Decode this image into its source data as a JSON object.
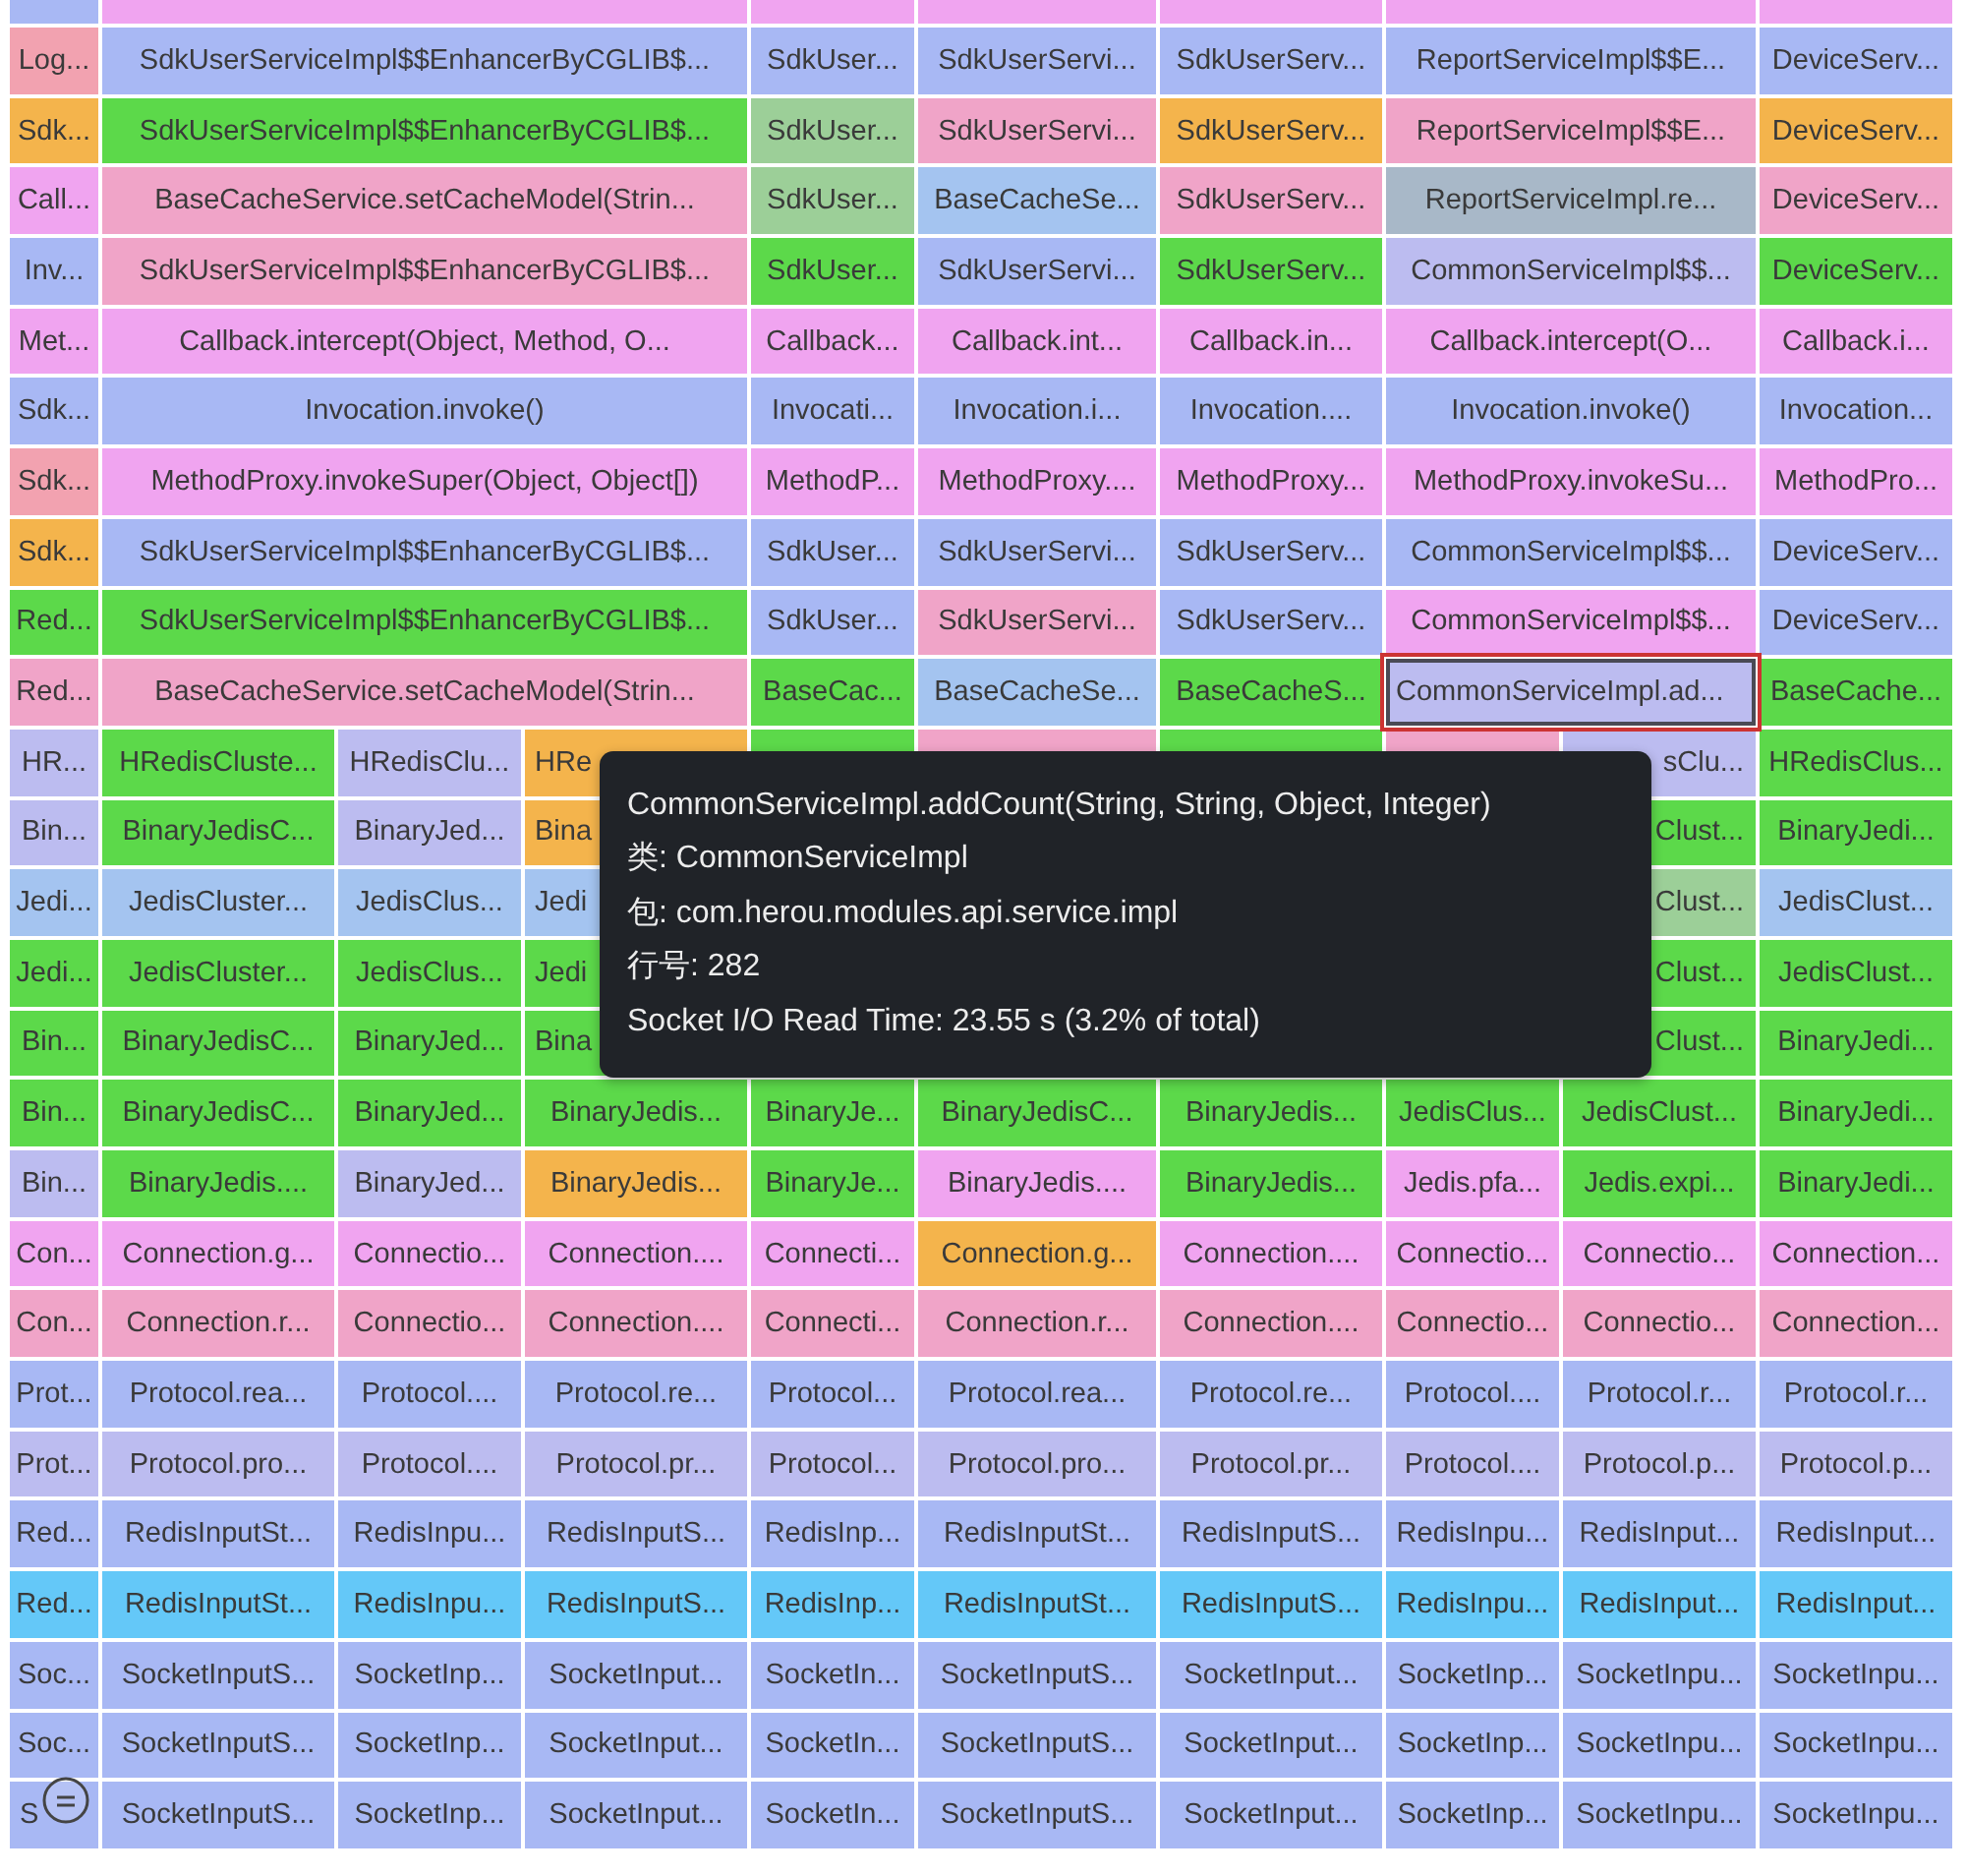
{
  "flame_graph": {
    "rows": [
      {
        "frames": [
          {
            "kind": "bare",
            "color": "#a8b8f4",
            "selected": false
          },
          {
            "kind": "bare",
            "color": "#f0a4f0",
            "selected": false
          },
          {
            "kind": "bare",
            "color": "#f0a4f0",
            "selected": false
          },
          {
            "kind": "bare",
            "color": "#f0a4f0",
            "selected": false
          },
          {
            "kind": "bare",
            "color": "#f0a4f0",
            "selected": false
          },
          {
            "kind": "bare",
            "color": "#f0a4f0",
            "selected": false
          },
          {
            "kind": "bare",
            "color": "#f0a4f0",
            "selected": false
          }
        ]
      },
      {
        "frames": [
          {
            "label": "Log...",
            "color": "#f2a2b0",
            "selected": false
          },
          {
            "label": "SdkUserServiceImpl$$EnhancerByCGLIB$...",
            "color": "#a8b8f4",
            "selected": false
          },
          {
            "label": "SdkUser...",
            "color": "#a8b8f4",
            "selected": false
          },
          {
            "label": "SdkUserServi...",
            "color": "#a8b8f4",
            "selected": false
          },
          {
            "label": "SdkUserServ...",
            "color": "#a8b8f4",
            "selected": false
          },
          {
            "label": "ReportServiceImpl$$E...",
            "color": "#a8b8f4",
            "selected": false
          },
          {
            "label": "DeviceServ...",
            "color": "#a8b8f4",
            "selected": false
          }
        ]
      },
      {
        "frames": [
          {
            "label": "Sdk...",
            "color": "#f4b44c",
            "selected": false
          },
          {
            "label": "SdkUserServiceImpl$$EnhancerByCGLIB$...",
            "color": "#5cd94a",
            "selected": false
          },
          {
            "label": "SdkUser...",
            "color": "#9ccf98",
            "selected": false
          },
          {
            "label": "SdkUserServi...",
            "color": "#f0a4c8",
            "selected": false
          },
          {
            "label": "SdkUserServ...",
            "color": "#f4b44c",
            "selected": false
          },
          {
            "label": "ReportServiceImpl$$E...",
            "color": "#f0a4c8",
            "selected": false
          },
          {
            "label": "DeviceServ...",
            "color": "#f4b44c",
            "selected": false
          }
        ]
      },
      {
        "frames": [
          {
            "label": "Call...",
            "color": "#f0a4f0",
            "selected": false
          },
          {
            "label": "BaseCacheService.setCacheModel(Strin...",
            "color": "#f0a4c8",
            "selected": false
          },
          {
            "label": "SdkUser...",
            "color": "#9ccf98",
            "selected": false
          },
          {
            "label": "BaseCacheSe...",
            "color": "#a4c4f0",
            "selected": false
          },
          {
            "label": "SdkUserServ...",
            "color": "#f0a4c8",
            "selected": false
          },
          {
            "label": "ReportServiceImpl.re...",
            "color": "#a8b8c8",
            "selected": false
          },
          {
            "label": "DeviceServ...",
            "color": "#f0a4c8",
            "selected": false
          }
        ]
      },
      {
        "frames": [
          {
            "label": "Inv...",
            "color": "#a8b8f4",
            "selected": false
          },
          {
            "label": "SdkUserServiceImpl$$EnhancerByCGLIB$...",
            "color": "#f0a4c8",
            "selected": false
          },
          {
            "label": "SdkUser...",
            "color": "#5cd94a",
            "selected": false
          },
          {
            "label": "SdkUserServi...",
            "color": "#a8b8f4",
            "selected": false
          },
          {
            "label": "SdkUserServ...",
            "color": "#5cd94a",
            "selected": false
          },
          {
            "label": "CommonServiceImpl$$...",
            "color": "#bcbcf0",
            "selected": false
          },
          {
            "label": "DeviceServ...",
            "color": "#5cd94a",
            "selected": false
          }
        ]
      },
      {
        "frames": [
          {
            "label": "Met...",
            "color": "#f0a4f0",
            "selected": false
          },
          {
            "label": "Callback.intercept(Object, Method, O...",
            "color": "#f0a4f0",
            "selected": false
          },
          {
            "label": "Callback...",
            "color": "#f0a4f0",
            "selected": false
          },
          {
            "label": "Callback.int...",
            "color": "#f0a4f0",
            "selected": false
          },
          {
            "label": "Callback.in...",
            "color": "#f0a4f0",
            "selected": false
          },
          {
            "label": "Callback.intercept(O...",
            "color": "#f0a4f0",
            "selected": false
          },
          {
            "label": "Callback.i...",
            "color": "#f0a4f0",
            "selected": false
          }
        ]
      },
      {
        "frames": [
          {
            "label": "Sdk...",
            "color": "#a8b8f4",
            "selected": false
          },
          {
            "label": "Invocation.invoke()",
            "color": "#a8b8f4",
            "selected": false
          },
          {
            "label": "Invocati...",
            "color": "#a8b8f4",
            "selected": false
          },
          {
            "label": "Invocation.i...",
            "color": "#a8b8f4",
            "selected": false
          },
          {
            "label": "Invocation....",
            "color": "#a8b8f4",
            "selected": false
          },
          {
            "label": "Invocation.invoke()",
            "color": "#a8b8f4",
            "selected": false
          },
          {
            "label": "Invocation...",
            "color": "#a8b8f4",
            "selected": false
          }
        ]
      },
      {
        "frames": [
          {
            "label": "Sdk...",
            "color": "#f2a2b0",
            "selected": false
          },
          {
            "label": "MethodProxy.invokeSuper(Object, Object[])",
            "color": "#f0a4f0",
            "selected": false
          },
          {
            "label": "MethodP...",
            "color": "#f0a4f0",
            "selected": false
          },
          {
            "label": "MethodProxy....",
            "color": "#f0a4f0",
            "selected": false
          },
          {
            "label": "MethodProxy...",
            "color": "#f0a4f0",
            "selected": false
          },
          {
            "label": "MethodProxy.invokeSu...",
            "color": "#f0a4f0",
            "selected": false
          },
          {
            "label": "MethodPro...",
            "color": "#f0a4f0",
            "selected": false
          }
        ]
      },
      {
        "frames": [
          {
            "label": "Sdk...",
            "color": "#f4b44c",
            "selected": false
          },
          {
            "label": "SdkUserServiceImpl$$EnhancerByCGLIB$...",
            "color": "#a8b8f4",
            "selected": false
          },
          {
            "label": "SdkUser...",
            "color": "#a8b8f4",
            "selected": false
          },
          {
            "label": "SdkUserServi...",
            "color": "#a8b8f4",
            "selected": false
          },
          {
            "label": "SdkUserServ...",
            "color": "#a8b8f4",
            "selected": false
          },
          {
            "label": "CommonServiceImpl$$...",
            "color": "#a8b8f4",
            "selected": false
          },
          {
            "label": "DeviceServ...",
            "color": "#a8b8f4",
            "selected": false
          }
        ]
      },
      {
        "frames": [
          {
            "label": "Red...",
            "color": "#5cd94a",
            "selected": false
          },
          {
            "label": "SdkUserServiceImpl$$EnhancerByCGLIB$...",
            "color": "#5cd94a",
            "selected": false
          },
          {
            "label": "SdkUser...",
            "color": "#a8b8f4",
            "selected": false
          },
          {
            "label": "SdkUserServi...",
            "color": "#f0a4c8",
            "selected": false
          },
          {
            "label": "SdkUserServ...",
            "color": "#a8b8f4",
            "selected": false
          },
          {
            "label": "CommonServiceImpl$$...",
            "color": "#f0a4f0",
            "selected": false
          },
          {
            "label": "DeviceServ...",
            "color": "#a8b8f4",
            "selected": false
          }
        ]
      },
      {
        "frames": [
          {
            "label": "Red...",
            "color": "#f0a4c8",
            "selected": false
          },
          {
            "label": "BaseCacheService.setCacheModel(Strin...",
            "color": "#f0a4c8",
            "selected": false
          },
          {
            "label": "BaseCac...",
            "color": "#5cd94a",
            "selected": false
          },
          {
            "label": "BaseCacheSe...",
            "color": "#a4c4f0",
            "selected": false
          },
          {
            "label": "BaseCacheS...",
            "color": "#5cd94a",
            "selected": false
          },
          {
            "label": "CommonServiceImpl.ad...",
            "color": "#bcbcf0",
            "selected": true
          },
          {
            "label": "BaseCache...",
            "color": "#5cd94a",
            "selected": false
          }
        ]
      },
      {
        "frames": [
          {
            "label": "HR...",
            "color": "#bcbcf0",
            "selected": false
          },
          {
            "label": "HRedisCluste...",
            "color": "#5cd94a",
            "selected": false
          },
          {
            "label": "HRedisClu...",
            "color": "#bcbcf0",
            "selected": false
          },
          {
            "kind": "partial-left",
            "label": "HRe",
            "color": "#f4b44c",
            "selected": false
          },
          {
            "kind": "bare",
            "color": "#5cd94a",
            "selected": false
          },
          {
            "kind": "bare",
            "color": "#f0a4c8",
            "selected": false
          },
          {
            "kind": "bare",
            "color": "#5cd94a",
            "selected": false
          },
          {
            "kind": "bare",
            "color": "#f0a4c8",
            "selected": false
          },
          {
            "kind": "partial-right",
            "label": "sClu...",
            "color": "#bcbcf0",
            "selected": false
          },
          {
            "label": "HRedisClus...",
            "color": "#5cd94a",
            "selected": false
          }
        ]
      },
      {
        "frames": [
          {
            "label": "Bin...",
            "color": "#bcbcf0",
            "selected": false
          },
          {
            "label": "BinaryJedisC...",
            "color": "#5cd94a",
            "selected": false
          },
          {
            "label": "BinaryJed...",
            "color": "#bcbcf0",
            "selected": false
          },
          {
            "kind": "partial-left",
            "label": "Bina",
            "color": "#f4b44c",
            "selected": false
          },
          {
            "kind": "hidden"
          },
          {
            "kind": "hidden"
          },
          {
            "kind": "hidden"
          },
          {
            "kind": "hidden"
          },
          {
            "kind": "partial-right",
            "label": "Clust...",
            "color": "#5cd94a",
            "selected": false
          },
          {
            "label": "BinaryJedi...",
            "color": "#5cd94a",
            "selected": false
          }
        ]
      },
      {
        "frames": [
          {
            "label": "Jedi...",
            "color": "#a4c4f0",
            "selected": false
          },
          {
            "label": "JedisCluster...",
            "color": "#a4c4f0",
            "selected": false
          },
          {
            "label": "JedisClus...",
            "color": "#a4c4f0",
            "selected": false
          },
          {
            "kind": "partial-left",
            "label": "Jedi",
            "color": "#a4c4f0",
            "selected": false
          },
          {
            "kind": "hidden"
          },
          {
            "kind": "hidden"
          },
          {
            "kind": "hidden"
          },
          {
            "kind": "hidden"
          },
          {
            "kind": "partial-right",
            "label": "Clust...",
            "color": "#9ccf98",
            "selected": false
          },
          {
            "label": "JedisClust...",
            "color": "#a4c4f0",
            "selected": false
          }
        ]
      },
      {
        "frames": [
          {
            "label": "Jedi...",
            "color": "#5cd94a",
            "selected": false
          },
          {
            "label": "JedisCluster...",
            "color": "#5cd94a",
            "selected": false
          },
          {
            "label": "JedisClus...",
            "color": "#5cd94a",
            "selected": false
          },
          {
            "kind": "partial-left",
            "label": "Jedi",
            "color": "#5cd94a",
            "selected": false
          },
          {
            "kind": "hidden"
          },
          {
            "kind": "hidden"
          },
          {
            "kind": "hidden"
          },
          {
            "kind": "hidden"
          },
          {
            "kind": "partial-right",
            "label": "Clust...",
            "color": "#5cd94a",
            "selected": false
          },
          {
            "label": "JedisClust...",
            "color": "#5cd94a",
            "selected": false
          }
        ]
      },
      {
        "frames": [
          {
            "label": "Bin...",
            "color": "#5cd94a",
            "selected": false
          },
          {
            "label": "BinaryJedisC...",
            "color": "#5cd94a",
            "selected": false
          },
          {
            "label": "BinaryJed...",
            "color": "#5cd94a",
            "selected": false
          },
          {
            "kind": "partial-left",
            "label": "Bina",
            "color": "#5cd94a",
            "selected": false
          },
          {
            "kind": "hidden"
          },
          {
            "kind": "hidden"
          },
          {
            "kind": "hidden"
          },
          {
            "kind": "hidden"
          },
          {
            "kind": "partial-right",
            "label": "Clust...",
            "color": "#5cd94a",
            "selected": false
          },
          {
            "label": "BinaryJedi...",
            "color": "#5cd94a",
            "selected": false
          }
        ]
      },
      {
        "frames": [
          {
            "label": "Bin...",
            "color": "#5cd94a",
            "selected": false
          },
          {
            "label": "BinaryJedisC...",
            "color": "#5cd94a",
            "selected": false
          },
          {
            "label": "BinaryJed...",
            "color": "#5cd94a",
            "selected": false
          },
          {
            "label": "BinaryJedis...",
            "color": "#5cd94a",
            "selected": false
          },
          {
            "label": "BinaryJe...",
            "color": "#5cd94a",
            "selected": false
          },
          {
            "label": "BinaryJedisC...",
            "color": "#5cd94a",
            "selected": false
          },
          {
            "label": "BinaryJedis...",
            "color": "#5cd94a",
            "selected": false
          },
          {
            "label": "JedisClus...",
            "color": "#5cd94a",
            "selected": false
          },
          {
            "label": "JedisClust...",
            "color": "#5cd94a",
            "selected": false
          },
          {
            "label": "BinaryJedi...",
            "color": "#5cd94a",
            "selected": false
          }
        ]
      },
      {
        "frames": [
          {
            "label": "Bin...",
            "color": "#bcbcf0",
            "selected": false
          },
          {
            "label": "BinaryJedis....",
            "color": "#5cd94a",
            "selected": false
          },
          {
            "label": "BinaryJed...",
            "color": "#bcbcf0",
            "selected": false
          },
          {
            "label": "BinaryJedis...",
            "color": "#f4b44c",
            "selected": false
          },
          {
            "label": "BinaryJe...",
            "color": "#5cd94a",
            "selected": false
          },
          {
            "label": "BinaryJedis....",
            "color": "#f0a4f0",
            "selected": false
          },
          {
            "label": "BinaryJedis...",
            "color": "#5cd94a",
            "selected": false
          },
          {
            "label": "Jedis.pfa...",
            "color": "#f0a4f0",
            "selected": false
          },
          {
            "label": "Jedis.expi...",
            "color": "#5cd94a",
            "selected": false
          },
          {
            "label": "BinaryJedi...",
            "color": "#5cd94a",
            "selected": false
          }
        ]
      },
      {
        "frames": [
          {
            "label": "Con...",
            "color": "#f0a4f0",
            "selected": false
          },
          {
            "label": "Connection.g...",
            "color": "#f0a4f0",
            "selected": false
          },
          {
            "label": "Connectio...",
            "color": "#f0a4f0",
            "selected": false
          },
          {
            "label": "Connection....",
            "color": "#f0a4f0",
            "selected": false
          },
          {
            "label": "Connecti...",
            "color": "#f0a4f0",
            "selected": false
          },
          {
            "label": "Connection.g...",
            "color": "#f4b44c",
            "selected": false
          },
          {
            "label": "Connection....",
            "color": "#f0a4f0",
            "selected": false
          },
          {
            "label": "Connectio...",
            "color": "#f0a4f0",
            "selected": false
          },
          {
            "label": "Connectio...",
            "color": "#f0a4f0",
            "selected": false
          },
          {
            "label": "Connection...",
            "color": "#f0a4f0",
            "selected": false
          }
        ]
      },
      {
        "frames": [
          {
            "label": "Con...",
            "color": "#f0a4c8",
            "selected": false
          },
          {
            "label": "Connection.r...",
            "color": "#f0a4c8",
            "selected": false
          },
          {
            "label": "Connectio...",
            "color": "#f0a4c8",
            "selected": false
          },
          {
            "label": "Connection....",
            "color": "#f0a4c8",
            "selected": false
          },
          {
            "label": "Connecti...",
            "color": "#f0a4c8",
            "selected": false
          },
          {
            "label": "Connection.r...",
            "color": "#f0a4c8",
            "selected": false
          },
          {
            "label": "Connection....",
            "color": "#f0a4c8",
            "selected": false
          },
          {
            "label": "Connectio...",
            "color": "#f0a4c8",
            "selected": false
          },
          {
            "label": "Connectio...",
            "color": "#f0a4c8",
            "selected": false
          },
          {
            "label": "Connection...",
            "color": "#f0a4c8",
            "selected": false
          }
        ]
      },
      {
        "frames": [
          {
            "label": "Prot...",
            "color": "#a8b8f4",
            "selected": false
          },
          {
            "label": "Protocol.rea...",
            "color": "#a8b8f4",
            "selected": false
          },
          {
            "label": "Protocol....",
            "color": "#a8b8f4",
            "selected": false
          },
          {
            "label": "Protocol.re...",
            "color": "#a8b8f4",
            "selected": false
          },
          {
            "label": "Protocol...",
            "color": "#a8b8f4",
            "selected": false
          },
          {
            "label": "Protocol.rea...",
            "color": "#a8b8f4",
            "selected": false
          },
          {
            "label": "Protocol.re...",
            "color": "#a8b8f4",
            "selected": false
          },
          {
            "label": "Protocol....",
            "color": "#a8b8f4",
            "selected": false
          },
          {
            "label": "Protocol.r...",
            "color": "#a8b8f4",
            "selected": false
          },
          {
            "label": "Protocol.r...",
            "color": "#a8b8f4",
            "selected": false
          }
        ]
      },
      {
        "frames": [
          {
            "label": "Prot...",
            "color": "#bcbcf0",
            "selected": false
          },
          {
            "label": "Protocol.pro...",
            "color": "#bcbcf0",
            "selected": false
          },
          {
            "label": "Protocol....",
            "color": "#bcbcf0",
            "selected": false
          },
          {
            "label": "Protocol.pr...",
            "color": "#bcbcf0",
            "selected": false
          },
          {
            "label": "Protocol...",
            "color": "#bcbcf0",
            "selected": false
          },
          {
            "label": "Protocol.pro...",
            "color": "#bcbcf0",
            "selected": false
          },
          {
            "label": "Protocol.pr...",
            "color": "#bcbcf0",
            "selected": false
          },
          {
            "label": "Protocol....",
            "color": "#bcbcf0",
            "selected": false
          },
          {
            "label": "Protocol.p...",
            "color": "#bcbcf0",
            "selected": false
          },
          {
            "label": "Protocol.p...",
            "color": "#bcbcf0",
            "selected": false
          }
        ]
      },
      {
        "frames": [
          {
            "label": "Red...",
            "color": "#a8b8f4",
            "selected": false
          },
          {
            "label": "RedisInputSt...",
            "color": "#a8b8f4",
            "selected": false
          },
          {
            "label": "RedisInpu...",
            "color": "#a8b8f4",
            "selected": false
          },
          {
            "label": "RedisInputS...",
            "color": "#a8b8f4",
            "selected": false
          },
          {
            "label": "RedisInp...",
            "color": "#a8b8f4",
            "selected": false
          },
          {
            "label": "RedisInputSt...",
            "color": "#a8b8f4",
            "selected": false
          },
          {
            "label": "RedisInputS...",
            "color": "#a8b8f4",
            "selected": false
          },
          {
            "label": "RedisInpu...",
            "color": "#a8b8f4",
            "selected": false
          },
          {
            "label": "RedisInput...",
            "color": "#a8b8f4",
            "selected": false
          },
          {
            "label": "RedisInput...",
            "color": "#a8b8f4",
            "selected": false
          }
        ]
      },
      {
        "frames": [
          {
            "label": "Red...",
            "color": "#64c8f8",
            "selected": false
          },
          {
            "label": "RedisInputSt...",
            "color": "#64c8f8",
            "selected": false
          },
          {
            "label": "RedisInpu...",
            "color": "#64c8f8",
            "selected": false
          },
          {
            "label": "RedisInputS...",
            "color": "#64c8f8",
            "selected": false
          },
          {
            "label": "RedisInp...",
            "color": "#64c8f8",
            "selected": false
          },
          {
            "label": "RedisInputSt...",
            "color": "#64c8f8",
            "selected": false
          },
          {
            "label": "RedisInputS...",
            "color": "#64c8f8",
            "selected": false
          },
          {
            "label": "RedisInpu...",
            "color": "#64c8f8",
            "selected": false
          },
          {
            "label": "RedisInput...",
            "color": "#64c8f8",
            "selected": false
          },
          {
            "label": "RedisInput...",
            "color": "#64c8f8",
            "selected": false
          }
        ]
      },
      {
        "frames": [
          {
            "label": "Soc...",
            "color": "#a8b8f4",
            "selected": false
          },
          {
            "label": "SocketInputS...",
            "color": "#a8b8f4",
            "selected": false
          },
          {
            "label": "SocketInp...",
            "color": "#a8b8f4",
            "selected": false
          },
          {
            "label": "SocketInput...",
            "color": "#a8b8f4",
            "selected": false
          },
          {
            "label": "SocketIn...",
            "color": "#a8b8f4",
            "selected": false
          },
          {
            "label": "SocketInputS...",
            "color": "#a8b8f4",
            "selected": false
          },
          {
            "label": "SocketInput...",
            "color": "#a8b8f4",
            "selected": false
          },
          {
            "label": "SocketInp...",
            "color": "#a8b8f4",
            "selected": false
          },
          {
            "label": "SocketInpu...",
            "color": "#a8b8f4",
            "selected": false
          },
          {
            "label": "SocketInpu...",
            "color": "#a8b8f4",
            "selected": false
          }
        ]
      },
      {
        "frames": [
          {
            "label": "Soc...",
            "color": "#a8b8f4",
            "selected": false
          },
          {
            "label": "SocketInputS...",
            "color": "#a8b8f4",
            "selected": false
          },
          {
            "label": "SocketInp...",
            "color": "#a8b8f4",
            "selected": false
          },
          {
            "label": "SocketInput...",
            "color": "#a8b8f4",
            "selected": false
          },
          {
            "label": "SocketIn...",
            "color": "#a8b8f4",
            "selected": false
          },
          {
            "label": "SocketInputS...",
            "color": "#a8b8f4",
            "selected": false
          },
          {
            "label": "SocketInput...",
            "color": "#a8b8f4",
            "selected": false
          },
          {
            "label": "SocketInp...",
            "color": "#a8b8f4",
            "selected": false
          },
          {
            "label": "SocketInpu...",
            "color": "#a8b8f4",
            "selected": false
          },
          {
            "label": "SocketInpu...",
            "color": "#a8b8f4",
            "selected": false
          }
        ]
      },
      {
        "frames": [
          {
            "kind": "partial-left",
            "label": "S",
            "color": "#a8b8f4",
            "selected": false
          },
          {
            "label": "SocketInputS...",
            "color": "#a8b8f4",
            "selected": false
          },
          {
            "label": "SocketInp...",
            "color": "#a8b8f4",
            "selected": false
          },
          {
            "label": "SocketInput...",
            "color": "#a8b8f4",
            "selected": false
          },
          {
            "label": "SocketIn...",
            "color": "#a8b8f4",
            "selected": false
          },
          {
            "label": "SocketInputS...",
            "color": "#a8b8f4",
            "selected": false
          },
          {
            "label": "SocketInput...",
            "color": "#a8b8f4",
            "selected": false
          },
          {
            "label": "SocketInp...",
            "color": "#a8b8f4",
            "selected": false
          },
          {
            "label": "SocketInpu...",
            "color": "#a8b8f4",
            "selected": false
          },
          {
            "label": "SocketInpu...",
            "color": "#a8b8f4",
            "selected": false
          }
        ]
      }
    ]
  },
  "tooltip": {
    "lines": [
      "CommonServiceImpl.addCount(String, String, Object, Integer)",
      "类: CommonServiceImpl",
      "包: com.herou.modules.api.service.impl",
      "行号: 282",
      "Socket I/O Read Time: 23.55 s (3.2% of total)"
    ]
  }
}
